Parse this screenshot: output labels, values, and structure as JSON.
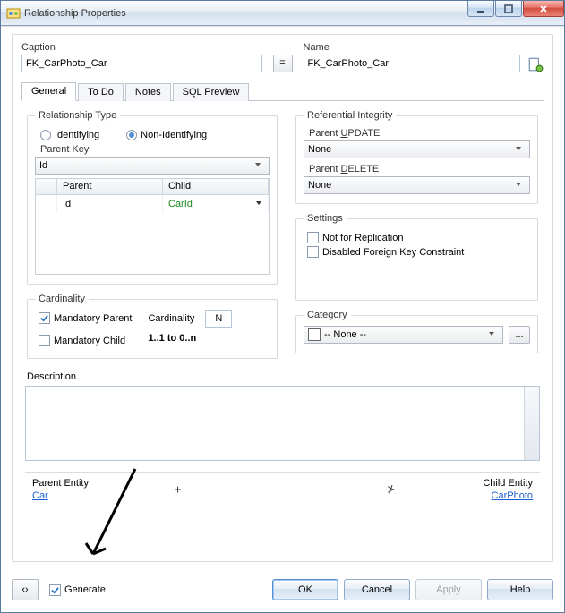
{
  "window": {
    "title": "Relationship Properties"
  },
  "fields": {
    "caption_label": "Caption",
    "caption_value": "FK_CarPhoto_Car",
    "name_label": "Name",
    "name_value": "FK_CarPhoto_Car",
    "equals": "="
  },
  "tabs": {
    "general": "General",
    "todo": "To Do",
    "notes": "Notes",
    "sql": "SQL Preview"
  },
  "rel_type": {
    "legend": "Relationship Type",
    "identifying": "Identifying",
    "non_identifying": "Non-Identifying",
    "parent_key_label": "Parent Key",
    "parent_key_value": "Id",
    "grid_parent_header": "Parent",
    "grid_child_header": "Child",
    "grid_parent_val": "Id",
    "grid_child_val": "CarId"
  },
  "cardinality": {
    "legend": "Cardinality",
    "mand_parent": "Mandatory Parent",
    "mand_child": "Mandatory Child",
    "card_label": "Cardinality",
    "card_value": "N",
    "range": "1..1 to 0..n"
  },
  "ref_integrity": {
    "legend": "Referential Integrity",
    "parent_update_pre": "Parent ",
    "parent_update_accel": "U",
    "parent_update_post": "PDATE",
    "update_value": "None",
    "parent_delete_pre": "Parent ",
    "parent_delete_accel": "D",
    "parent_delete_post": "ELETE",
    "delete_value": "None"
  },
  "settings": {
    "legend": "Settings",
    "not_for_replication": "Not for Replication",
    "disabled_fk": "Disabled Foreign Key Constraint"
  },
  "category": {
    "legend": "Category",
    "value": "-- None --",
    "ellipsis": "..."
  },
  "description": {
    "label": "Description"
  },
  "entities": {
    "parent_label": "Parent Entity",
    "parent_value": "Car",
    "child_label": "Child Entity",
    "child_value": "CarPhoto",
    "line": "+  —  —  —  —  —  —  —  —  —  —  ⊁"
  },
  "bottom": {
    "generate": "Generate",
    "ok": "OK",
    "cancel": "Cancel",
    "apply": "Apply",
    "help": "Help",
    "code_glyph": "‹›"
  }
}
